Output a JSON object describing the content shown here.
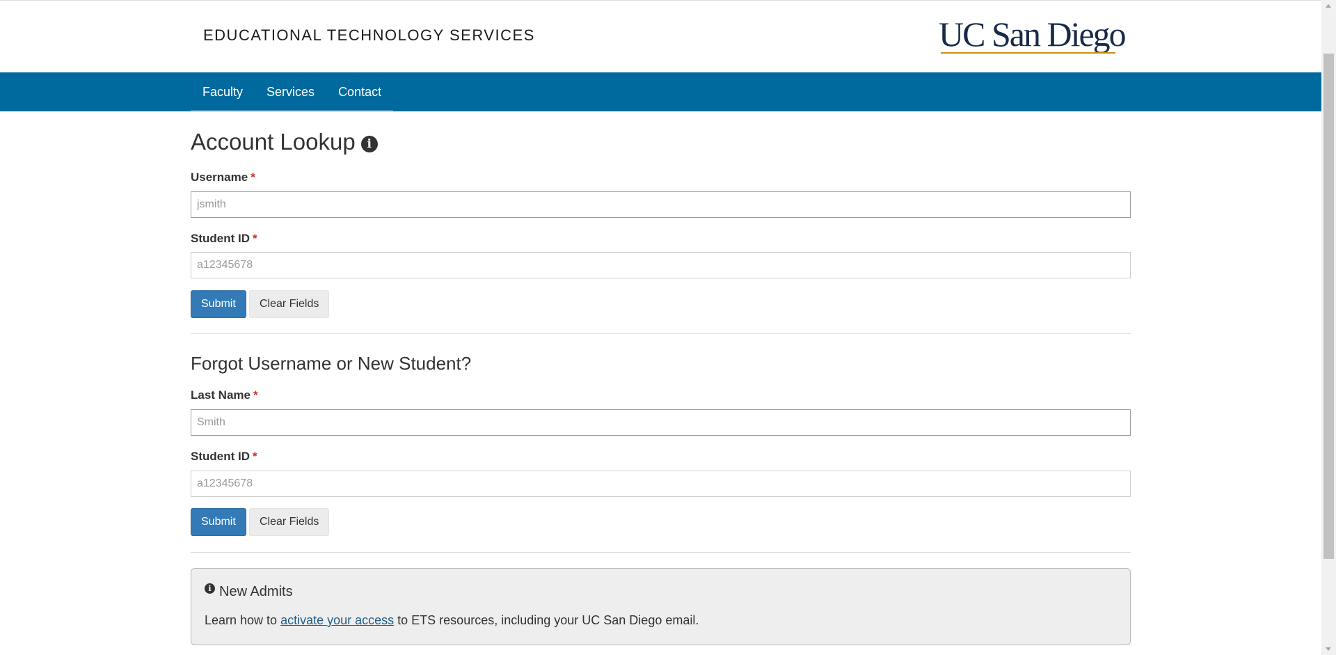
{
  "header": {
    "site_title": "EDUCATIONAL TECHNOLOGY SERVICES",
    "logo_text": "UC San Diego"
  },
  "nav": {
    "items": [
      {
        "label": "Faculty"
      },
      {
        "label": "Services"
      },
      {
        "label": "Contact"
      }
    ]
  },
  "account_lookup": {
    "title": "Account Lookup",
    "info_icon": "info-circle-icon",
    "username_label": "Username",
    "username_placeholder": "jsmith",
    "student_id_label": "Student ID",
    "student_id_placeholder": "a12345678",
    "required_marker": "*",
    "submit_label": "Submit",
    "clear_label": "Clear Fields"
  },
  "forgot_username": {
    "title": "Forgot Username or New Student?",
    "last_name_label": "Last Name",
    "last_name_placeholder": "Smith",
    "student_id_label": "Student ID",
    "student_id_placeholder": "a12345678",
    "required_marker": "*",
    "submit_label": "Submit",
    "clear_label": "Clear Fields"
  },
  "new_admits": {
    "title": "New Admits",
    "text_before": "Learn how to ",
    "link_text": "activate your access",
    "text_after": " to ETS resources, including your UC San Diego email."
  },
  "colors": {
    "nav_bg": "#006A9E",
    "primary_button": "#337ab7",
    "required": "#c9302c",
    "logo_navy": "#182B49",
    "logo_gold": "#C69214"
  }
}
